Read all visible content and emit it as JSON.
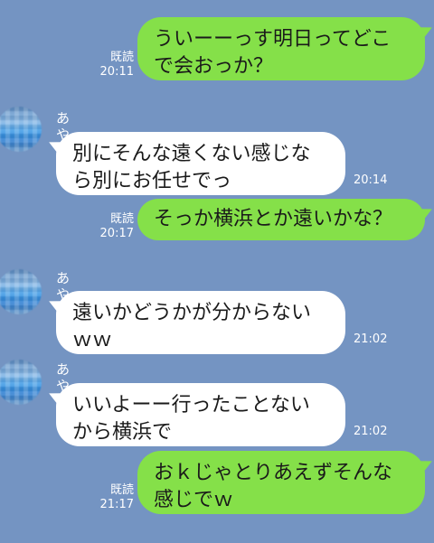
{
  "contact_name": "あやめ",
  "read_label": "既読",
  "messages": [
    {
      "dir": "out",
      "lines": [
        "ういーーっす明日ってどこ",
        "で会おっか？"
      ],
      "time": "20:11",
      "read": true
    },
    {
      "dir": "in",
      "sender": "あやめ",
      "lines": [
        "別にそんな遠くない感じな",
        "ら別にお任せでっ"
      ],
      "time": "20:14"
    },
    {
      "dir": "out",
      "lines": [
        "そっか横浜とか遠いかな？"
      ],
      "time": "20:17",
      "read": true
    },
    {
      "dir": "in",
      "sender": "あやめ",
      "lines": [
        "遠いかどうかが分からない",
        "ｗｗ"
      ],
      "time": "21:02"
    },
    {
      "dir": "in",
      "sender": "あやめ",
      "lines": [
        "いいよーー行ったことない",
        "から横浜で"
      ],
      "time": "21:02"
    },
    {
      "dir": "out",
      "lines": [
        "おｋじゃとりあえずそんな",
        "感じでｗ"
      ],
      "time": "21:17",
      "read": true
    }
  ],
  "colors": {
    "background": "#7494c2",
    "outgoing_bubble": "#85e049",
    "incoming_bubble": "#ffffff",
    "meta_text": "#ffffff"
  }
}
